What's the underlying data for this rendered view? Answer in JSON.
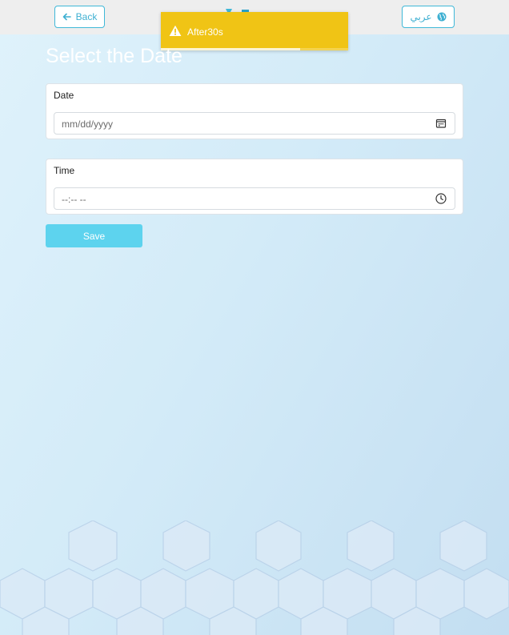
{
  "header": {
    "back_label": "Back",
    "language_label": "عربي"
  },
  "toast": {
    "message": "After30s",
    "progress": 0.745
  },
  "page": {
    "title": "Select the Date"
  },
  "date_field": {
    "label": "Date",
    "placeholder": "mm/dd/yyyy"
  },
  "time_field": {
    "label": "Time",
    "placeholder": "--:-- --"
  },
  "actions": {
    "save_label": "Save"
  },
  "colors": {
    "accent": "#3fb8d8",
    "save_button": "#5dd3ee",
    "toast_warning": "#f0c415",
    "topbar": "#eeeeee"
  },
  "icons": {
    "back": "arrow-left-icon",
    "language": "globe-icon",
    "warning": "warning-icon",
    "date": "calendar-icon",
    "time": "clock-icon"
  }
}
